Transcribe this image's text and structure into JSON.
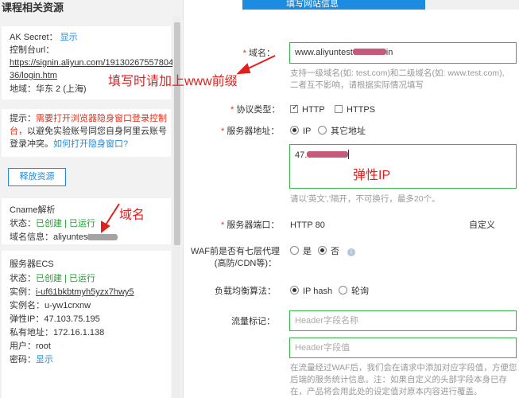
{
  "left": {
    "title": "课程相关资源",
    "ak": {
      "label": "AK Secret：",
      "show": "显示",
      "console_label": "控制台url：",
      "url_line1": "https://signin.aliyun.com/19130267557804",
      "url_line2": "36/login.htm",
      "region": "地域：华东 2 (上海)"
    },
    "tip": {
      "line1_prefix": "提示：",
      "line1_warn": "需要打开浏览器隐身窗口登录控制",
      "line2_warn": "台，",
      "line2_rest": "以避免实验账号同您自身阿里云账号",
      "line3_rest": "登录冲突。",
      "line3_link": "如何打开隐身窗口?"
    },
    "release_button": "释放资源",
    "cname": {
      "title": "Cname解析",
      "status_label": "状态：",
      "status_created": "已创建",
      "sep": "|",
      "status_running": "已运行",
      "domain_label": "域名信息：aliyuntest"
    },
    "ecs": {
      "title": "服务器ECS",
      "status_label": "状态：",
      "status_created": "已创建",
      "sep": "|",
      "status_running": "已运行",
      "instance_label": "实例：",
      "instance_id": "i-uf61bkbtmyh5yzx7hwy5",
      "instance_name": "实例名：u-yw1crxnw",
      "eip": "弹性IP：47.103.75.195",
      "private_ip": "私有地址：172.16.1.138",
      "user": "用户：root",
      "password_label": "密码：",
      "password_show": "显示"
    }
  },
  "right": {
    "banner": "填写网站信息",
    "domain": {
      "label": "域名：",
      "value": "www.aliyuntest",
      "value_tail": "in",
      "hint1": "支持一级域名(如: test.com)和二级域名(如: www.test.com),",
      "hint2": "二者互不影响，请根据实际情况填写"
    },
    "protocol": {
      "label": "协议类型：",
      "http": "HTTP",
      "https": "HTTPS"
    },
    "server_addr": {
      "label": "服务器地址：",
      "ip": "IP",
      "other": "其它地址"
    },
    "ip_box": {
      "value": "47.",
      "hint": "请以'英文','隔开，不可换行，最多20个。"
    },
    "port": {
      "label": "服务器端口：",
      "value": "HTTP 80",
      "custom": "自定义"
    },
    "proxy": {
      "label1": "WAF前是否有七层代理",
      "label2": "(高防/CDN等)：",
      "yes": "是",
      "no": "否",
      "info": "i"
    },
    "lb": {
      "label": "负载均衡算法：",
      "iphash": "IP hash",
      "rr": "轮询"
    },
    "flow": {
      "label": "流量标记：",
      "name_placeholder": "Header字段名称",
      "value_placeholder": "Header字段值",
      "hint1": "在流量经过WAF后，我们会在请求中添加对应字段值，方便您",
      "hint2": "后端的服务统计信息。注：如果自定义的头部字段本身已存",
      "hint3": "在，产品将会用此处的设定值对原本内容进行覆盖。"
    },
    "required_mark": "*"
  },
  "annotations": {
    "www": "填写时请加上www前缀",
    "eip": "弹性IP",
    "domain": "域名"
  },
  "colors": {
    "accent": "#1d8ce0",
    "green_border": "#36b24a",
    "annotation": "#e0201e"
  }
}
